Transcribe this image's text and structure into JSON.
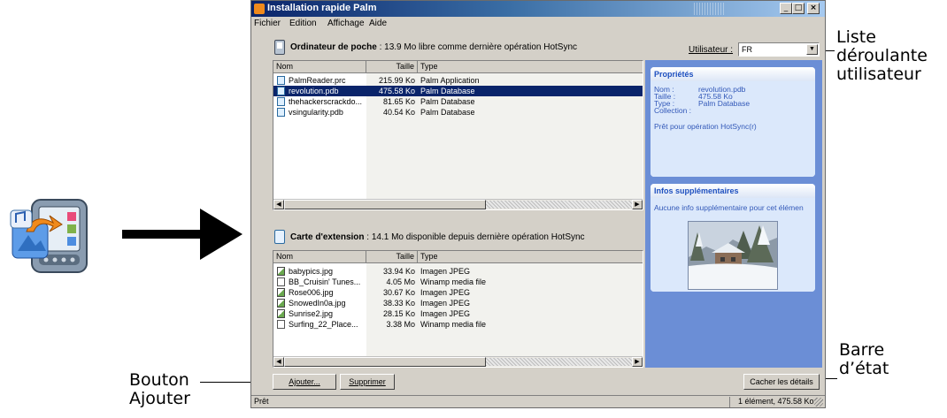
{
  "window": {
    "title": "Installation rapide Palm",
    "controls": [
      "minimize-icon",
      "maximize-icon",
      "close-icon"
    ]
  },
  "menu": [
    "Fichier",
    "Edition",
    "Affichage",
    "Aide"
  ],
  "handheld": {
    "label": "Ordinateur de poche",
    "info": " : 13.9 Mo libre comme dernière opération HotSync",
    "user_label": "Utilisateur :",
    "user_value": "FR",
    "columns": [
      "Nom",
      "Taille",
      "Type"
    ],
    "files": [
      {
        "name": "PalmReader.prc",
        "size": "215.99 Ko",
        "type": "Palm Application",
        "selected": false
      },
      {
        "name": "revolution.pdb",
        "size": "475.58 Ko",
        "type": "Palm Database",
        "selected": true
      },
      {
        "name": "thehackerscrackdo...",
        "size": "81.65 Ko",
        "type": "Palm Database",
        "selected": false
      },
      {
        "name": "vsingularity.pdb",
        "size": "40.54 Ko",
        "type": "Palm Database",
        "selected": false
      }
    ]
  },
  "card": {
    "label": "Carte d'extension",
    "info": " : 14.1 Mo disponible depuis dernière opération HotSync",
    "columns": [
      "Nom",
      "Taille",
      "Type"
    ],
    "files": [
      {
        "name": "babypics.jpg",
        "size": "33.94 Ko",
        "type": "Imagen JPEG"
      },
      {
        "name": "BB_Cruisin' Tunes...",
        "size": "4.05 Mo",
        "type": "Winamp media file"
      },
      {
        "name": "Rose006.jpg",
        "size": "30.67 Ko",
        "type": "Imagen JPEG"
      },
      {
        "name": "SnowedIn0a.jpg",
        "size": "38.33 Ko",
        "type": "Imagen JPEG"
      },
      {
        "name": "Sunrise2.jpg",
        "size": "28.15 Ko",
        "type": "Imagen JPEG"
      },
      {
        "name": "Surfing_22_Place...",
        "size": "3.38 Mo",
        "type": "Winamp media file"
      }
    ]
  },
  "properties": {
    "title": "Propriétés",
    "rows": [
      {
        "label": "Nom :",
        "value": "revolution.pdb"
      },
      {
        "label": "Taille :",
        "value": "475.58 Ko"
      },
      {
        "label": "Type :",
        "value": "Palm Database"
      },
      {
        "label": "Collection :",
        "value": ""
      }
    ],
    "status": "Prêt pour opération HotSync(r)"
  },
  "extra": {
    "title": "Infos supplémentaires",
    "text": "Aucune info supplémentaire pour cet élémen"
  },
  "buttons": {
    "add": "Ajouter...",
    "remove": "Supprimer",
    "hide_details": "Cacher les détails"
  },
  "statusbar": {
    "left": "Prêt",
    "right": "1 élément, 475.58 Ko"
  },
  "callouts": {
    "user_list": [
      "Liste",
      "déroulante",
      "utilisateur"
    ],
    "status_bar": [
      "Barre",
      "d’état"
    ],
    "add_button": [
      "Bouton",
      "Ajouter"
    ]
  },
  "colors": {
    "titlebar": "#0a246a",
    "selection": "#0a246a",
    "panel": "#6b8ed6",
    "card_title": "#1d4fbf"
  }
}
